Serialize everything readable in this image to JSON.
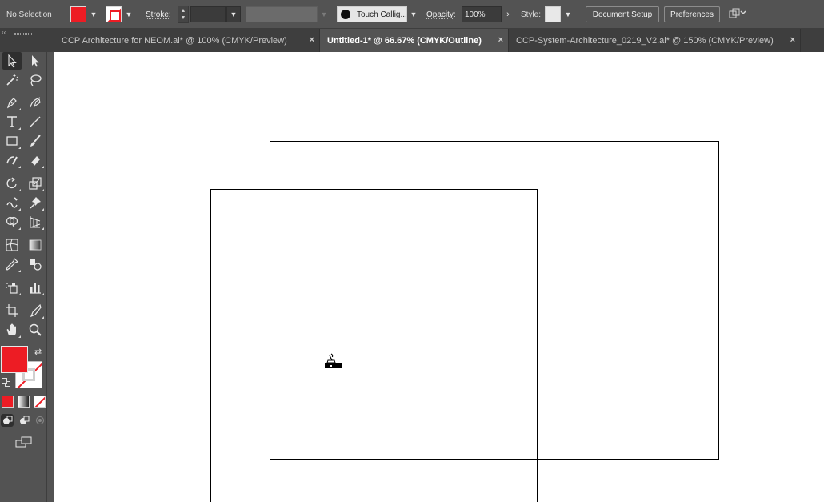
{
  "control_bar": {
    "selection_status": "No Selection",
    "fill_color": "#ed1c24",
    "stroke_label": "Stroke:",
    "stroke_weight": "",
    "brush_name": "Touch Callig...",
    "opacity_label": "Opacity:",
    "opacity_value": "100%",
    "style_label": "Style:",
    "document_setup_label": "Document Setup",
    "preferences_label": "Preferences"
  },
  "tabs": [
    {
      "label": "CCP Architecture for NEOM.ai* @ 100% (CMYK/Preview)",
      "active": false
    },
    {
      "label": "Untitled-1* @ 66.67% (CMYK/Outline)",
      "active": true
    },
    {
      "label": "CCP-System-Architecture_0219_V2.ai* @ 150% (CMYK/Preview)",
      "active": false
    }
  ],
  "tab_close_glyph": "×",
  "panel_collapse_glyph": "‹‹",
  "tools": [
    "selection-tool-icon",
    "direct-selection-tool-icon",
    "magic-wand-tool-icon",
    "lasso-tool-icon",
    "pen-tool-icon",
    "curvature-tool-icon",
    "type-tool-icon",
    "line-segment-tool-icon",
    "rectangle-tool-icon",
    "paintbrush-tool-icon",
    "shaper-tool-icon",
    "eraser-tool-icon",
    "rotate-tool-icon",
    "scale-tool-icon",
    "warp-tool-icon",
    "puppet-warp-tool-icon",
    "shape-builder-tool-icon",
    "perspective-grid-tool-icon",
    "mesh-tool-icon",
    "gradient-tool-icon",
    "eyedropper-tool-icon",
    "blend-tool-icon",
    "symbol-sprayer-tool-icon",
    "column-graph-tool-icon",
    "artboard-tool-icon",
    "slice-tool-icon",
    "hand-tool-icon",
    "zoom-tool-icon"
  ],
  "canvas": {
    "mode": "Outline",
    "background": "#ffffff"
  }
}
